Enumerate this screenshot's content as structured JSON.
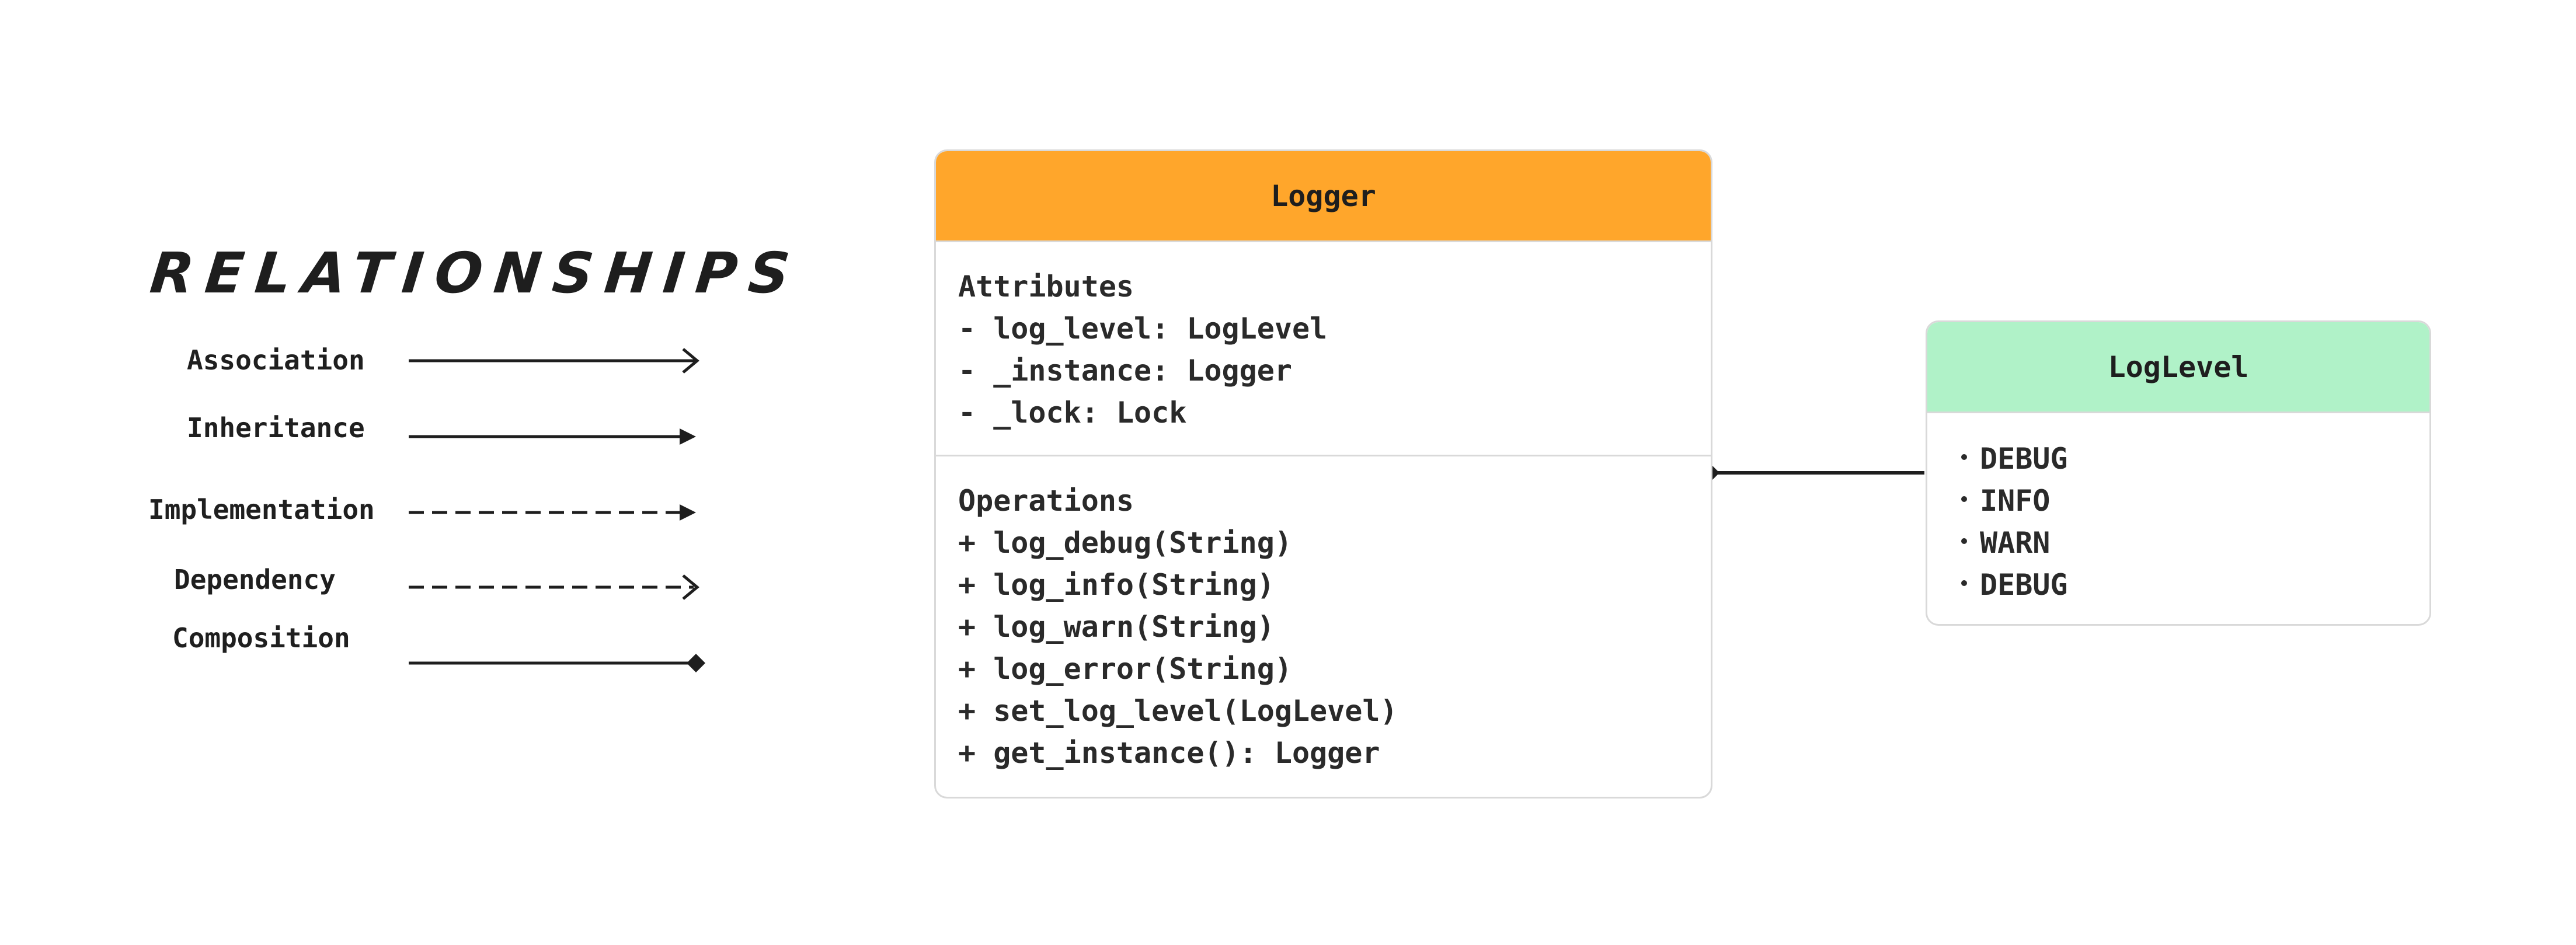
{
  "legend": {
    "title": "RELATIONSHIPS",
    "items": [
      {
        "label": "Association"
      },
      {
        "label": "Inheritance"
      },
      {
        "label": "Implementation"
      },
      {
        "label": "Dependency"
      },
      {
        "label": "Composition"
      }
    ]
  },
  "logger": {
    "name": "Logger",
    "header_color": "#ffa62b",
    "attributes_title": "Attributes",
    "attributes": [
      "- log_level: LogLevel",
      "- _instance: Logger",
      "- _lock: Lock"
    ],
    "operations_title": "Operations",
    "operations": [
      "+ log_debug(String)",
      "+ log_info(String)",
      "+ log_warn(String)",
      "+ log_error(String)",
      "+ set_log_level(LogLevel)",
      "+ get_instance(): Logger"
    ]
  },
  "loglevel": {
    "name": "LogLevel",
    "header_color": "#b0f2c8",
    "values": [
      "DEBUG",
      "INFO",
      "WARN",
      "DEBUG"
    ]
  },
  "relation": {
    "from": "Logger",
    "to": "LogLevel",
    "type": "Composition"
  }
}
